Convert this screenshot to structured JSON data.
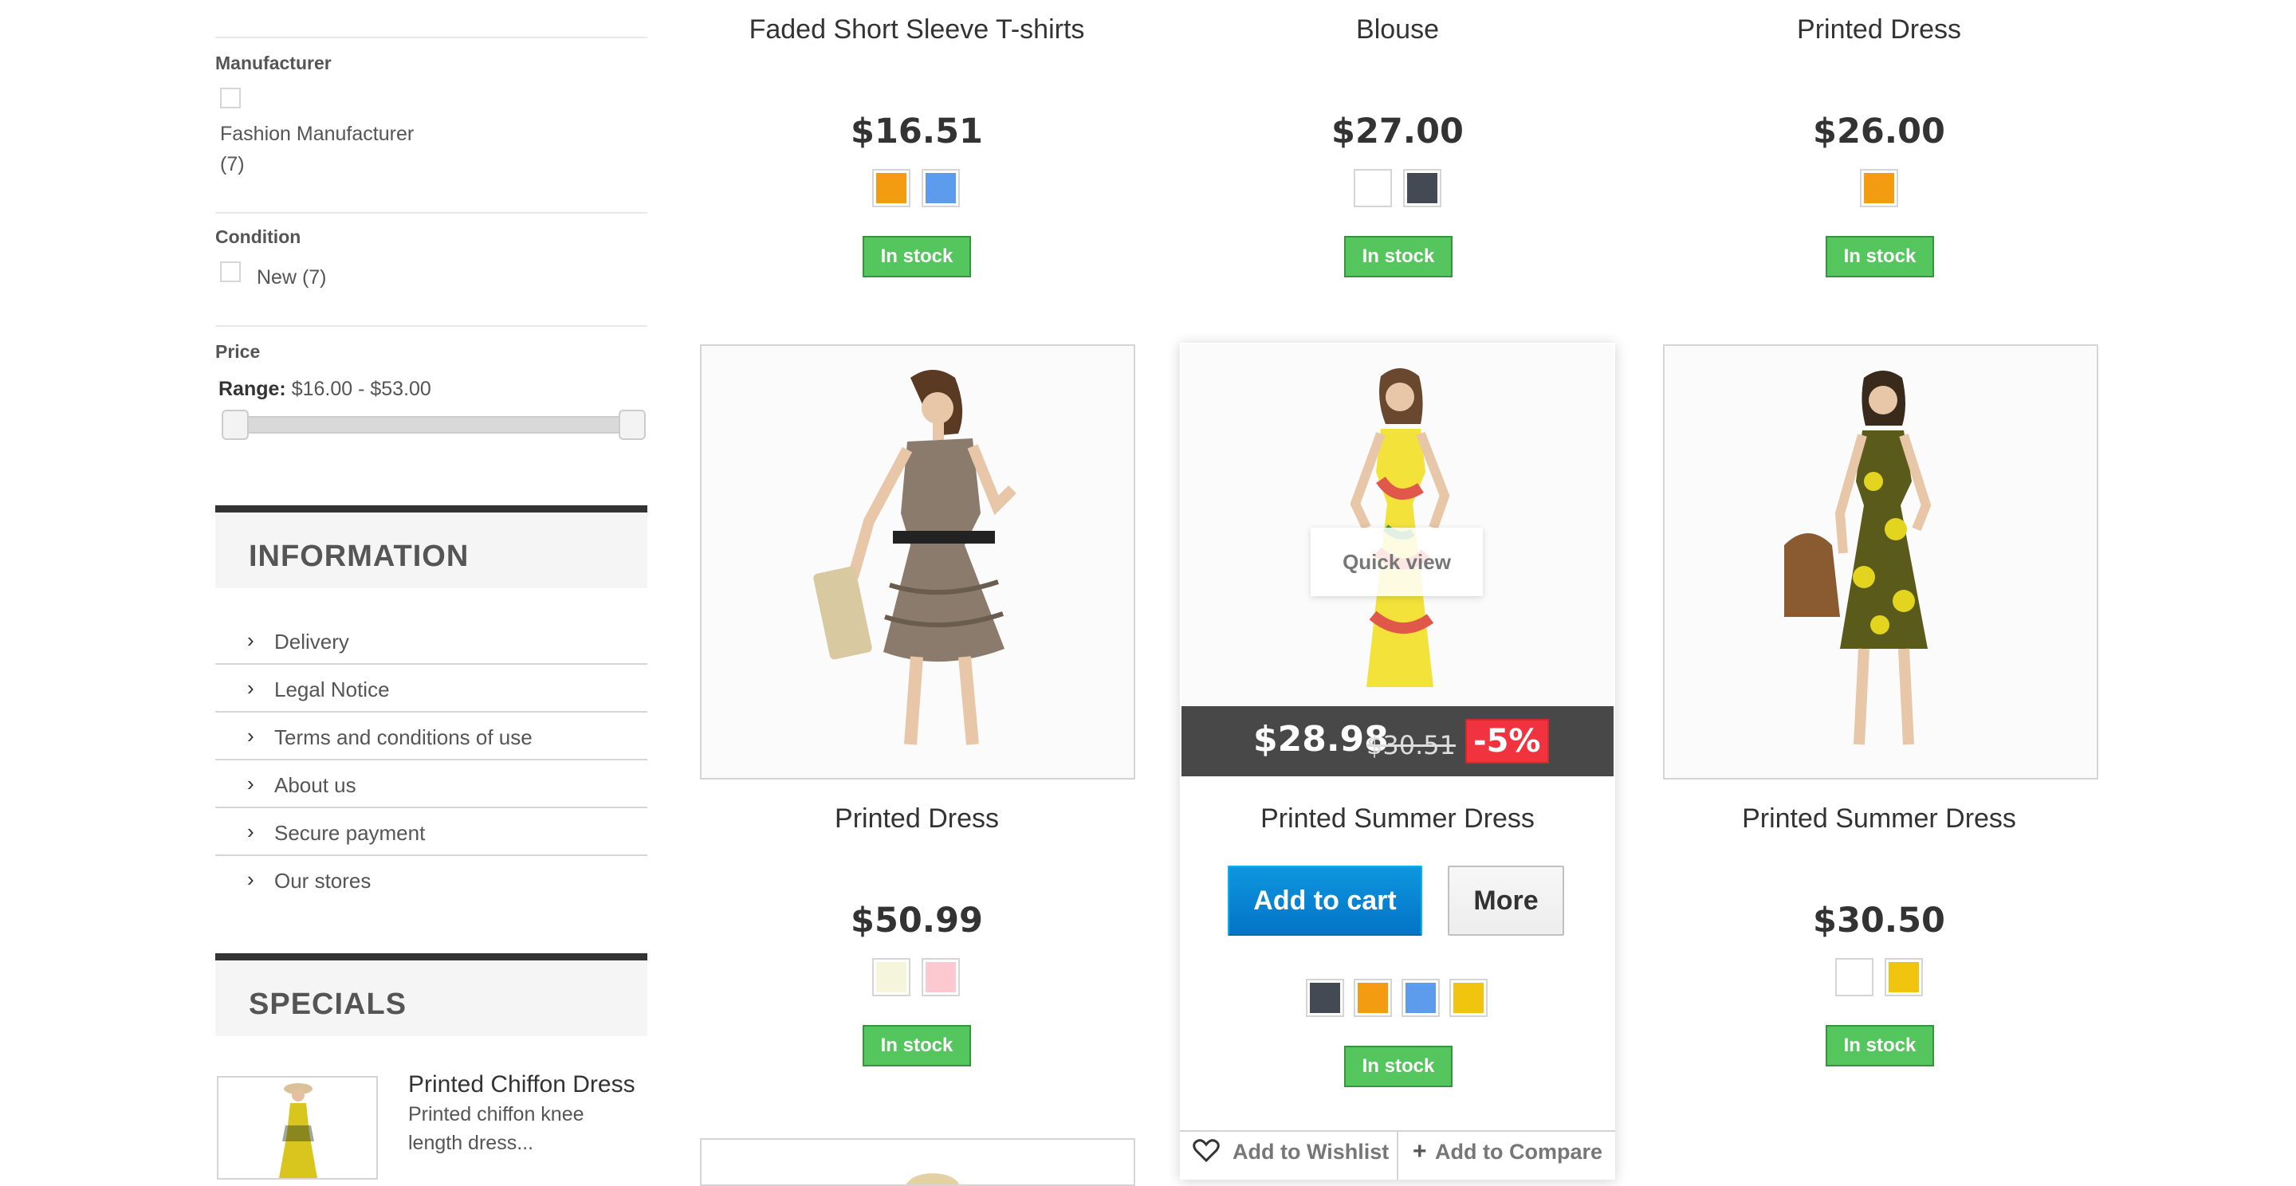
{
  "sidebar": {
    "manufacturer": {
      "title": "Manufacturer",
      "option_label": "Fashion Manufacturer",
      "option_count": "(7)"
    },
    "condition": {
      "title": "Condition",
      "option_label": "New (7)"
    },
    "price": {
      "title": "Price",
      "range_label": "Range:",
      "range_value": "$16.00 - $53.00"
    },
    "information": {
      "title": "INFORMATION",
      "items": [
        {
          "label": "Delivery"
        },
        {
          "label": "Legal Notice"
        },
        {
          "label": "Terms and conditions of use"
        },
        {
          "label": "About us"
        },
        {
          "label": "Secure payment"
        },
        {
          "label": "Our stores"
        }
      ]
    },
    "specials": {
      "title": "SPECIALS",
      "product_name": "Printed Chiffon Dress",
      "product_desc_1": "Printed chiffon knee",
      "product_desc_2": "length dress..."
    }
  },
  "row1": [
    {
      "name": "Faded Short Sleeve T-shirts",
      "price": "$16.51",
      "stock": "In stock",
      "swatches": [
        "#f39c11",
        "#5d9cec"
      ]
    },
    {
      "name": "Blouse",
      "price": "$27.00",
      "stock": "In stock",
      "swatches": [
        "#ffffff",
        "#434a54"
      ]
    },
    {
      "name": "Printed Dress",
      "price": "$26.00",
      "stock": "In stock",
      "swatches": [
        "#f39c11"
      ]
    }
  ],
  "row2": [
    {
      "name": "Printed Dress",
      "price": "$50.99",
      "stock": "In stock",
      "swatches": [
        "#f5f5dc",
        "#fcc9d0"
      ]
    },
    {
      "name": "Printed Summer Dress",
      "price": "$28.98",
      "old_price": "$30.51",
      "discount": "-5%",
      "stock": "In stock",
      "swatches": [
        "#434a54",
        "#f39c11",
        "#5d9cec",
        "#f1c40f"
      ],
      "quick_view": "Quick view",
      "add_to_cart": "Add to cart",
      "more": "More",
      "wishlist": "Add to Wishlist",
      "compare": "Add to Compare"
    },
    {
      "name": "Printed Summer Dress",
      "price": "$30.50",
      "stock": "In stock",
      "swatches": [
        "#ffffff",
        "#f1c40f"
      ]
    }
  ],
  "colors": {
    "in_stock": "#55c65e",
    "discount": "#f13340",
    "cart_button": "#0474c6"
  }
}
